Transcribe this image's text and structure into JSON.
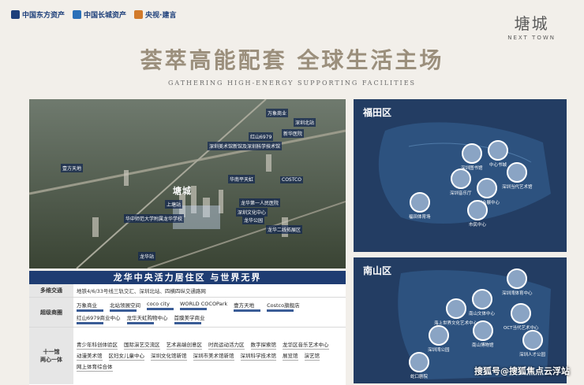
{
  "header": {
    "logos": [
      "中国东方资产",
      "中国长城资产",
      "央视·建言"
    ],
    "brand_cn": "塘城",
    "brand_en": "NEXT TOWN",
    "title": "荟萃高能配套 全球生活主场",
    "subtitle": "GATHERING HIGH-ENERGY SUPPORTING FACILITIES"
  },
  "aerial": {
    "project_label": "塘城",
    "tags": [
      "万象商业",
      "深圳北站",
      "红山6979",
      "深圳美术馆新馆及深圳科学技术馆",
      "新华医院",
      "壹方天地",
      "COSTCO",
      "华南平天虹",
      "华中师范大学附属龙华学校",
      "龙华公园",
      "上塘站",
      "龙华站",
      "龙华第一人民医院",
      "深圳文化中心",
      "龙华二线拓展区"
    ]
  },
  "table": {
    "heading": "龙华中央活力居住区 与世界无界",
    "rows": [
      {
        "label": "多维交通",
        "items": [
          "地铁4/6/33号线三轨交汇、深圳北站、四横四纵交通路网"
        ]
      },
      {
        "label": "超级商圈",
        "items": [
          "万象商业",
          "北站领展空间",
          "coco city",
          "WORLD COCOPark",
          "壹方天地",
          "Costco旗舰店",
          "红山6979商业中心",
          "龙华天虹购物中心",
          "首膜美学商业"
        ]
      },
      {
        "label": "十一馆\n两心一体",
        "items": [
          "青少年科创体验区",
          "国际演艺交流区",
          "艺术高端创意区",
          "时尚运动活力区",
          "数字探索馆",
          "龙华区音乐艺术中心",
          "动漫美术馆",
          "区妇女儿童中心",
          "深圳文化馆新馆",
          "深圳市美术馆新馆",
          "深圳科学技术馆",
          "展览馆",
          "演艺馆",
          "网上体育综合体"
        ]
      }
    ]
  },
  "maps": {
    "futian": {
      "title": "福田区",
      "pois": [
        "深圳图书馆",
        "中心书城",
        "深圳音乐厅",
        "深圳会展中心",
        "深圳当代艺术馆",
        "福田体育场",
        "市民中心"
      ]
    },
    "nanshan": {
      "title": "南山区",
      "pois": [
        "深圳湾体育中心",
        "南山文体中心",
        "海上世界文化艺术中心",
        "OCT当代艺术中心",
        "南山博物馆",
        "深圳湾公园",
        "深圳人才公园",
        "蛇口剧院"
      ]
    }
  },
  "watermark": "搜狐号@搜狐焦点云浮站"
}
